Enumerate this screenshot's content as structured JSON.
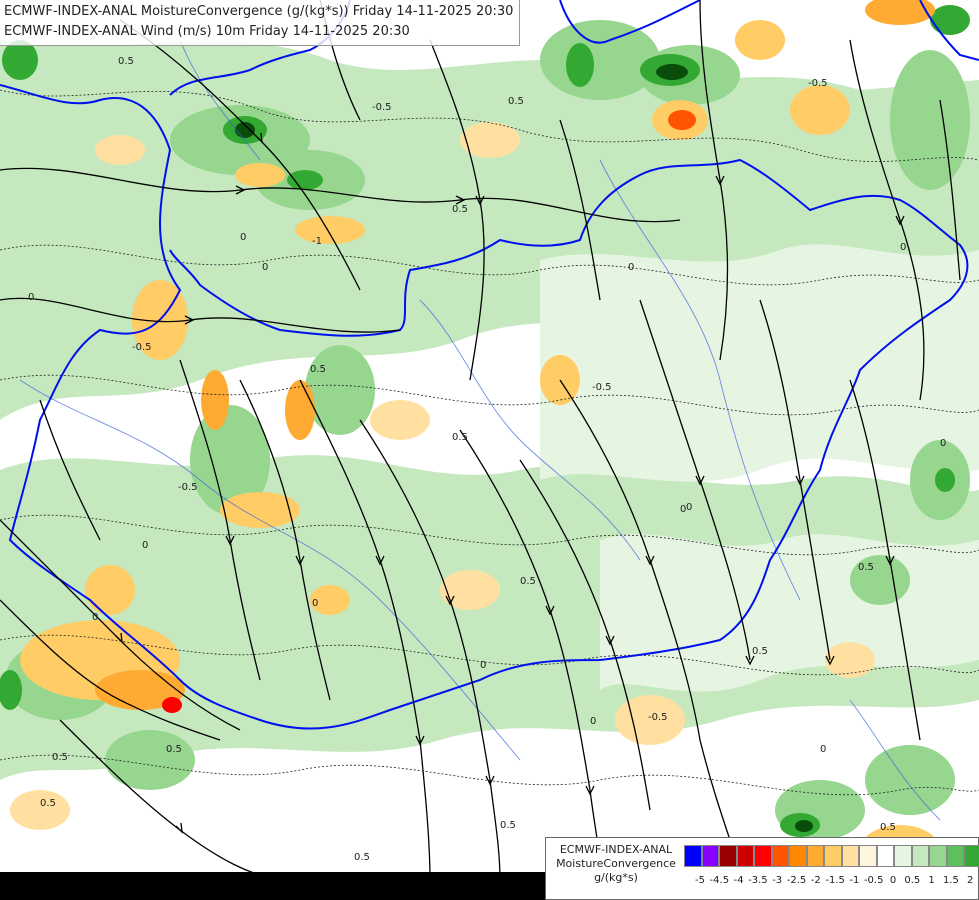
{
  "titles": {
    "line1": "ECMWF-INDEX-ANAL MoistureConvergence (g/(kg*s)) Friday 14-11-2025 20:30",
    "line2": "ECMWF-INDEX-ANAL Wind (m/s) 10m Friday 14-11-2025 20:30"
  },
  "legend": {
    "model": "ECMWF-INDEX-ANAL",
    "parameter": "MoistureConvergence",
    "unit": "g/(kg*s)",
    "colors": [
      "#0000ff",
      "#8800ff",
      "#990000",
      "#cc0000",
      "#ff0000",
      "#ff5500",
      "#ff8800",
      "#ffaa33",
      "#ffcc66",
      "#ffe0a0",
      "#fff4dd",
      "#ffffff",
      "#e6f5e2",
      "#c5e8bf",
      "#96d68e",
      "#5fbf5a",
      "#33a833",
      "#118a11"
    ],
    "ticks": [
      "-5",
      "-4.5",
      "-4",
      "-3.5",
      "-3",
      "-2.5",
      "-2",
      "-1.5",
      "-1",
      "-0.5",
      "0",
      "0.5",
      "1",
      "1.5",
      "2"
    ]
  },
  "contour_labels": [
    "0.5",
    "0",
    "-0.5",
    "0.5",
    "0",
    "-1",
    "0",
    "0.5",
    "-0.5",
    "0.5",
    "0",
    "0",
    "-0.5",
    "0.5",
    "0",
    "0.5",
    "-0.5",
    "0",
    "0.5",
    "0",
    "0.5",
    "0",
    "0",
    "0.5",
    "0",
    "-0.5",
    "0.5",
    "0",
    "0.5",
    "0.5",
    "0",
    "0.5",
    "0",
    "-0.5",
    "0.5",
    "0"
  ]
}
